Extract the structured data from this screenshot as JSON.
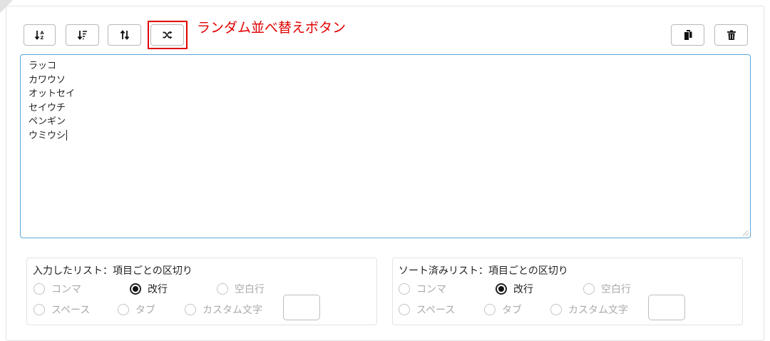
{
  "toolbar": {
    "buttons": [
      {
        "icon": "sort-ascending-az-icon"
      },
      {
        "icon": "sort-descending-icon"
      },
      {
        "icon": "reverse-order-icon"
      },
      {
        "icon": "shuffle-icon"
      },
      {
        "icon": "copy-icon"
      },
      {
        "icon": "trash-icon"
      }
    ]
  },
  "annotation": {
    "text": "ランダム並べ替えボタン",
    "color": "#e00000"
  },
  "editor": {
    "lines": [
      "ラッコ",
      "カワウソ",
      "オットセイ",
      "セイウチ",
      "ペンギン",
      "ウミウシ"
    ],
    "focus_color": "#5aa7d8"
  },
  "input_options": {
    "legend": "入力したリスト：項目ごとの区切り",
    "radios": [
      {
        "label": "コンマ",
        "selected": false
      },
      {
        "label": "改行",
        "selected": true
      },
      {
        "label": "空白行",
        "selected": false
      },
      {
        "label": "スペース",
        "selected": false
      },
      {
        "label": "タブ",
        "selected": false
      },
      {
        "label": "カスタム文字",
        "selected": false
      }
    ],
    "custom_value": ""
  },
  "sorted_options": {
    "legend": "ソート済みリスト：項目ごとの区切り",
    "radios": [
      {
        "label": "コンマ",
        "selected": false
      },
      {
        "label": "改行",
        "selected": true
      },
      {
        "label": "空白行",
        "selected": false
      },
      {
        "label": "スペース",
        "selected": false
      },
      {
        "label": "タブ",
        "selected": false
      },
      {
        "label": "カスタム文字",
        "selected": false
      }
    ],
    "custom_value": ""
  }
}
